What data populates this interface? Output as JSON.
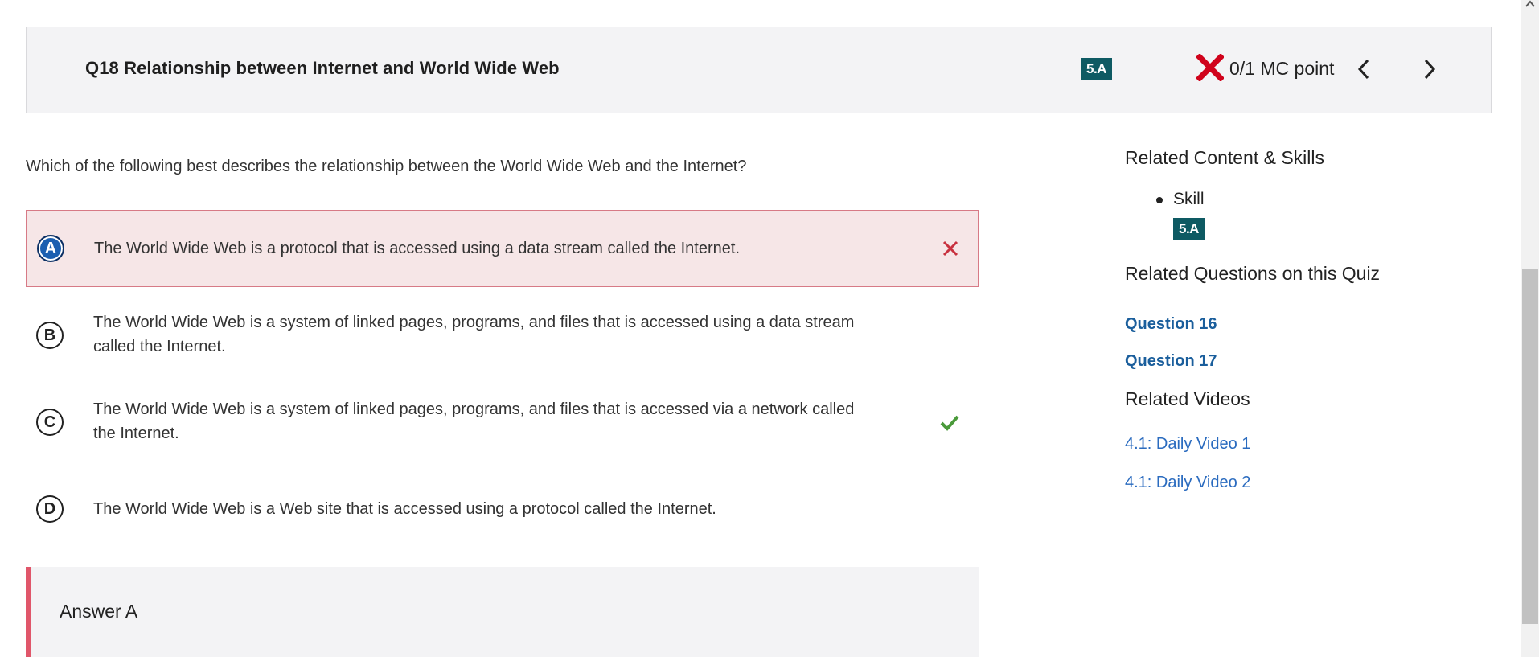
{
  "header": {
    "title": "Q18 Relationship between Internet and World Wide Web",
    "skill": "5.A",
    "score": "0/1 MC point",
    "prev_icon": "chevron-left-icon",
    "next_icon": "chevron-right-icon"
  },
  "question": {
    "prompt": "Which of the following best describes the relationship between the World Wide Web and the Internet?",
    "choices": [
      {
        "letter": "A",
        "text": "The World Wide Web is a protocol that is accessed using a data stream called the Internet.",
        "selected": true,
        "status": "incorrect"
      },
      {
        "letter": "B",
        "text": "The World Wide Web is a system of linked pages, programs, and files that is accessed using a data stream called the Internet.",
        "selected": false,
        "status": ""
      },
      {
        "letter": "C",
        "text": "The World Wide Web is a system of linked pages, programs, and files that is accessed via a network called the Internet.",
        "selected": false,
        "status": "correct"
      },
      {
        "letter": "D",
        "text": "The World Wide Web is a Web site that is accessed using a protocol called the Internet.",
        "selected": false,
        "status": ""
      }
    ],
    "answer_label": "Answer A"
  },
  "sidebar": {
    "related_content_heading": "Related Content & Skills",
    "skill_label": "Skill",
    "skill_code": "5.A",
    "related_questions_heading": "Related Questions on this Quiz",
    "questions": [
      "Question 16",
      "Question 17"
    ],
    "related_videos_heading": "Related Videos",
    "videos": [
      "4.1: Daily Video 1",
      "4.1: Daily Video 2"
    ]
  },
  "colors": {
    "skill_badge": "#0e5a63",
    "incorrect": "#d0021b",
    "correct": "#4a9a3a",
    "selected_letter": "#1b5fb0",
    "link": "#1a5e9c",
    "wrong_bg": "#f6e6e7"
  }
}
